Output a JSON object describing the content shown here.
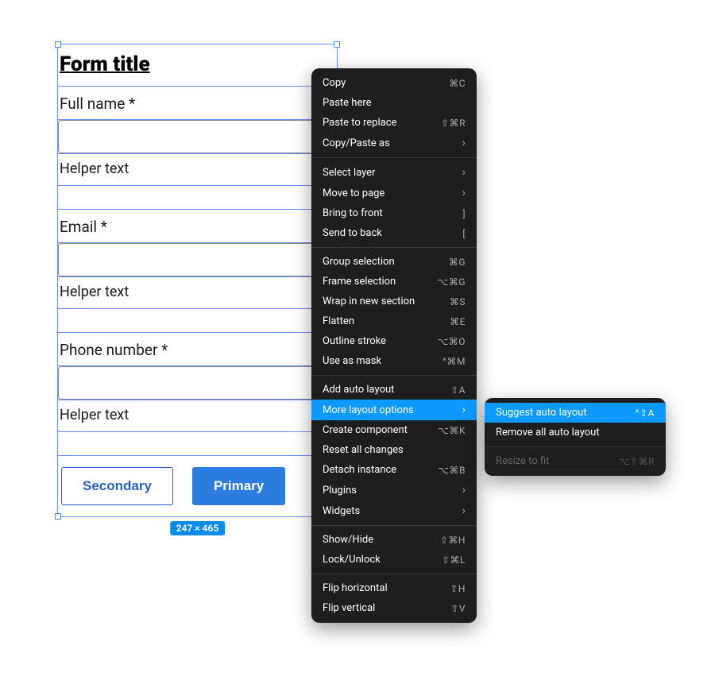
{
  "form": {
    "title": "Form title",
    "fields": [
      {
        "label": "Full name  *",
        "helper": "Helper text"
      },
      {
        "label": "Email  *",
        "helper": "Helper text"
      },
      {
        "label": "Phone number  *",
        "helper": "Helper text"
      }
    ],
    "buttons": {
      "secondary": "Secondary",
      "primary": "Primary"
    },
    "dimensions": "247 × 465"
  },
  "contextMenu": {
    "groups": [
      [
        {
          "label": "Copy",
          "shortcut": "⌘C"
        },
        {
          "label": "Paste here",
          "shortcut": ""
        },
        {
          "label": "Paste to replace",
          "shortcut": "⇧⌘R"
        },
        {
          "label": "Copy/Paste as",
          "submenu": true
        }
      ],
      [
        {
          "label": "Select layer",
          "submenu": true
        },
        {
          "label": "Move to page",
          "submenu": true
        },
        {
          "label": "Bring to front",
          "shortcut": "]"
        },
        {
          "label": "Send to back",
          "shortcut": "["
        }
      ],
      [
        {
          "label": "Group selection",
          "shortcut": "⌘G"
        },
        {
          "label": "Frame selection",
          "shortcut": "⌥⌘G"
        },
        {
          "label": "Wrap in new section",
          "shortcut": "⌘S"
        },
        {
          "label": "Flatten",
          "shortcut": "⌘E"
        },
        {
          "label": "Outline stroke",
          "shortcut": "⌥⌘O"
        },
        {
          "label": "Use as mask",
          "shortcut": "^⌘M"
        }
      ],
      [
        {
          "label": "Add auto layout",
          "shortcut": "⇧A"
        },
        {
          "label": "More layout options",
          "submenu": true,
          "highlighted": true
        },
        {
          "label": "Create component",
          "shortcut": "⌥⌘K"
        },
        {
          "label": "Reset all changes",
          "shortcut": ""
        },
        {
          "label": "Detach instance",
          "shortcut": "⌥⌘B"
        },
        {
          "label": "Plugins",
          "submenu": true
        },
        {
          "label": "Widgets",
          "submenu": true
        }
      ],
      [
        {
          "label": "Show/Hide",
          "shortcut": "⇧⌘H"
        },
        {
          "label": "Lock/Unlock",
          "shortcut": "⇧⌘L"
        }
      ],
      [
        {
          "label": "Flip horizontal",
          "shortcut": "⇧H"
        },
        {
          "label": "Flip vertical",
          "shortcut": "⇧V"
        }
      ]
    ]
  },
  "submenu": {
    "items": [
      {
        "label": "Suggest auto layout",
        "shortcut": "^⇧A",
        "highlighted": true
      },
      {
        "label": "Remove all auto layout",
        "shortcut": ""
      }
    ],
    "disabledItems": [
      {
        "label": "Resize to fit",
        "shortcut": "⌥⇧⌘R"
      }
    ]
  }
}
